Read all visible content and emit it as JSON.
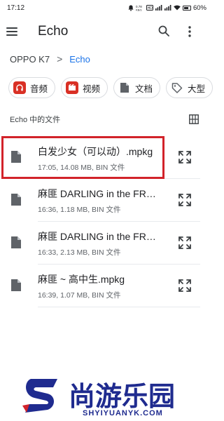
{
  "status_bar": {
    "time": "17:12",
    "net_speed": "0.78\nKB/s",
    "battery": "60%"
  },
  "app_bar": {
    "title": "Echo",
    "icons": [
      "menu-icon",
      "search-icon",
      "more-vert-icon"
    ]
  },
  "breadcrumb": {
    "root": "OPPO K7",
    "separator": ">",
    "current": "Echo"
  },
  "filter_chips": [
    {
      "label": "音频",
      "icon": "headphones-icon",
      "color": "#d93025"
    },
    {
      "label": "视频",
      "icon": "film-icon",
      "color": "#d93025"
    },
    {
      "label": "文档",
      "icon": "document-icon",
      "color": "#5f6368"
    },
    {
      "label": "大型",
      "icon": "tag-icon",
      "color": "#5f6368"
    }
  ],
  "section": {
    "title": "Echo 中的文件"
  },
  "files": [
    {
      "name": "白发少女（可以动）.mpkg",
      "time": "17:05",
      "size": "14.08 MB",
      "type": "BIN 文件",
      "meta": "17:05, 14.08 MB, BIN 文件"
    },
    {
      "name": "麻匪 DARLING in the FRANXX.mpkg",
      "time": "16:36",
      "size": "1.18 MB",
      "type": "BIN 文件",
      "meta": "16:36, 1.18 MB, BIN 文件"
    },
    {
      "name": "麻匪 DARLING in the FRANXX.mpkg",
      "time": "16:33",
      "size": "2.13 MB",
      "type": "BIN 文件",
      "meta": "16:33, 2.13 MB, BIN 文件"
    },
    {
      "name": "麻匪 ~ 高中生.mpkg",
      "time": "16:39",
      "size": "1.07 MB",
      "type": "BIN 文件",
      "meta": "16:39, 1.07 MB, BIN 文件"
    }
  ],
  "highlight_color": "#d2232a",
  "watermark": {
    "name": "尚游乐园",
    "url": "SHYIYUANYK.COM",
    "color": "#1f2b8f",
    "accent": "#d2232a"
  }
}
